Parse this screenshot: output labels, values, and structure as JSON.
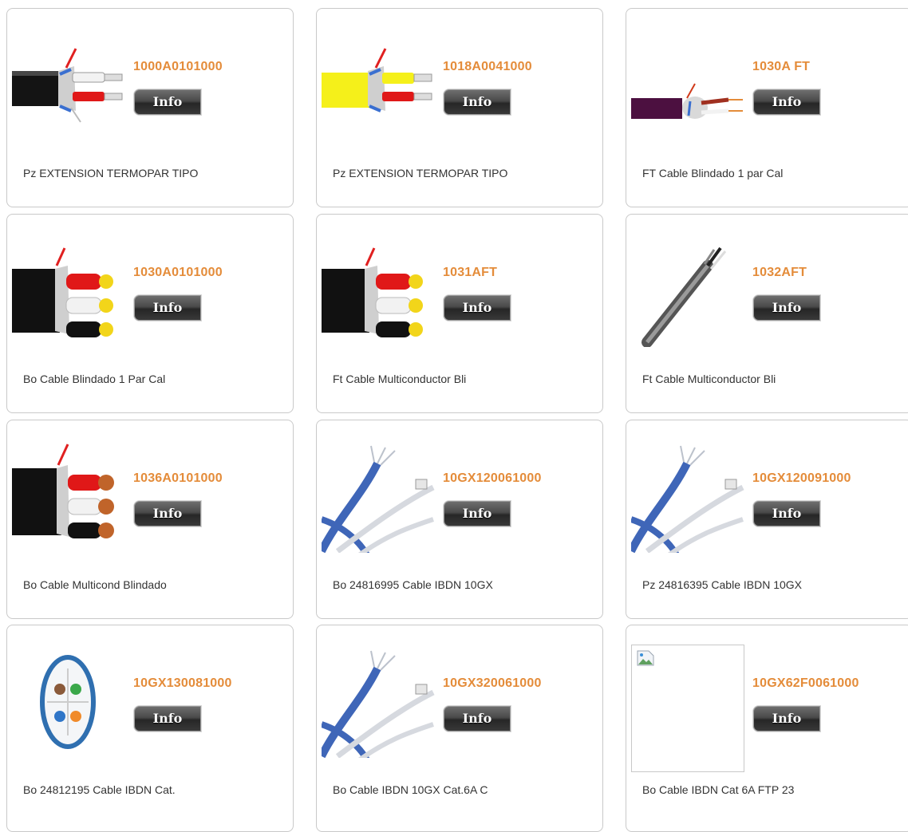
{
  "products": [
    {
      "code": "1000A0101000",
      "info_label": "Info",
      "description": "Pz EXTENSION TERMOPAR TIPO",
      "image": "cable-black-red-white-icon"
    },
    {
      "code": "1018A0041000",
      "info_label": "Info",
      "description": "Pz EXTENSION TERMOPAR TIPO",
      "image": "cable-yellow-red-white-icon"
    },
    {
      "code": "1030A FT",
      "info_label": "Info",
      "description": "FT Cable Blindado 1 par Cal",
      "image": "cable-purple-pair-icon"
    },
    {
      "code": "1030A0101000",
      "info_label": "Info",
      "description": "Bo Cable Blindado 1 Par Cal",
      "image": "cable-three-conductor-icon"
    },
    {
      "code": "1031AFT",
      "info_label": "Info",
      "description": "Ft Cable Multiconductor Bli",
      "image": "cable-three-conductor-icon"
    },
    {
      "code": "1032AFT",
      "info_label": "Info",
      "description": "Ft Cable Multiconductor Bli",
      "image": "cable-grey-diagonal-icon"
    },
    {
      "code": "1036A0101000",
      "info_label": "Info",
      "description": "Bo Cable Multicond Blindado",
      "image": "cable-three-conductor-copper-icon"
    },
    {
      "code": "10GX120061000",
      "info_label": "Info",
      "description": "Bo 24816995 Cable IBDN 10GX",
      "image": "cable-blue-network-icon"
    },
    {
      "code": "10GX120091000",
      "info_label": "Info",
      "description": "Pz 24816395 Cable IBDN 10GX",
      "image": "cable-blue-network-icon"
    },
    {
      "code": "10GX130081000",
      "info_label": "Info",
      "description": "Bo 24812195 Cable IBDN Cat.",
      "image": "cable-cross-section-icon"
    },
    {
      "code": "10GX320061000",
      "info_label": "Info",
      "description": "Bo Cable IBDN 10GX Cat.6A C",
      "image": "cable-blue-network-icon"
    },
    {
      "code": "10GX62F0061000",
      "info_label": "Info",
      "description": "Bo Cable IBDN Cat 6A FTP 23",
      "image": "broken-image-icon"
    }
  ],
  "colors": {
    "code": "#e48c3a",
    "description": "#333333",
    "border": "#c9c9c9",
    "button_dark": "#262626"
  }
}
